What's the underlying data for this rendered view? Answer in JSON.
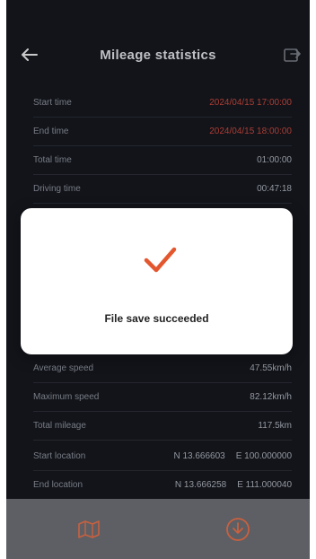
{
  "header": {
    "title": "Mileage statistics"
  },
  "stats": {
    "rows": [
      {
        "label": "Start time",
        "value": "2024/04/15 17:00:00",
        "red": true
      },
      {
        "label": "End time",
        "value": "2024/04/15 18:00:00",
        "red": true
      },
      {
        "label": "Total time",
        "value": "01:00:00"
      },
      {
        "label": "Driving time",
        "value": "00:47:18"
      }
    ],
    "lower_rows": [
      {
        "label": "Average speed",
        "value": "47.55km/h"
      },
      {
        "label": "Maximum speed",
        "value": "82.12km/h"
      },
      {
        "label": "Total mileage",
        "value": "117.5km"
      }
    ],
    "start_location": {
      "label": "Start location",
      "lat": "N 13.666603",
      "lng": "E 100.000000"
    },
    "end_location": {
      "label": "End location",
      "lat": "N 13.666258",
      "lng": "E 111.000040"
    }
  },
  "modal": {
    "message": "File save succeeded"
  },
  "colors": {
    "accent": "#e4572e",
    "background": "#15171e",
    "bottom_bar": "#5d5f64"
  },
  "icons": {
    "back": "arrow-left-icon",
    "export": "export-icon",
    "success": "checkmark-icon",
    "map": "map-icon",
    "download": "download-icon"
  }
}
